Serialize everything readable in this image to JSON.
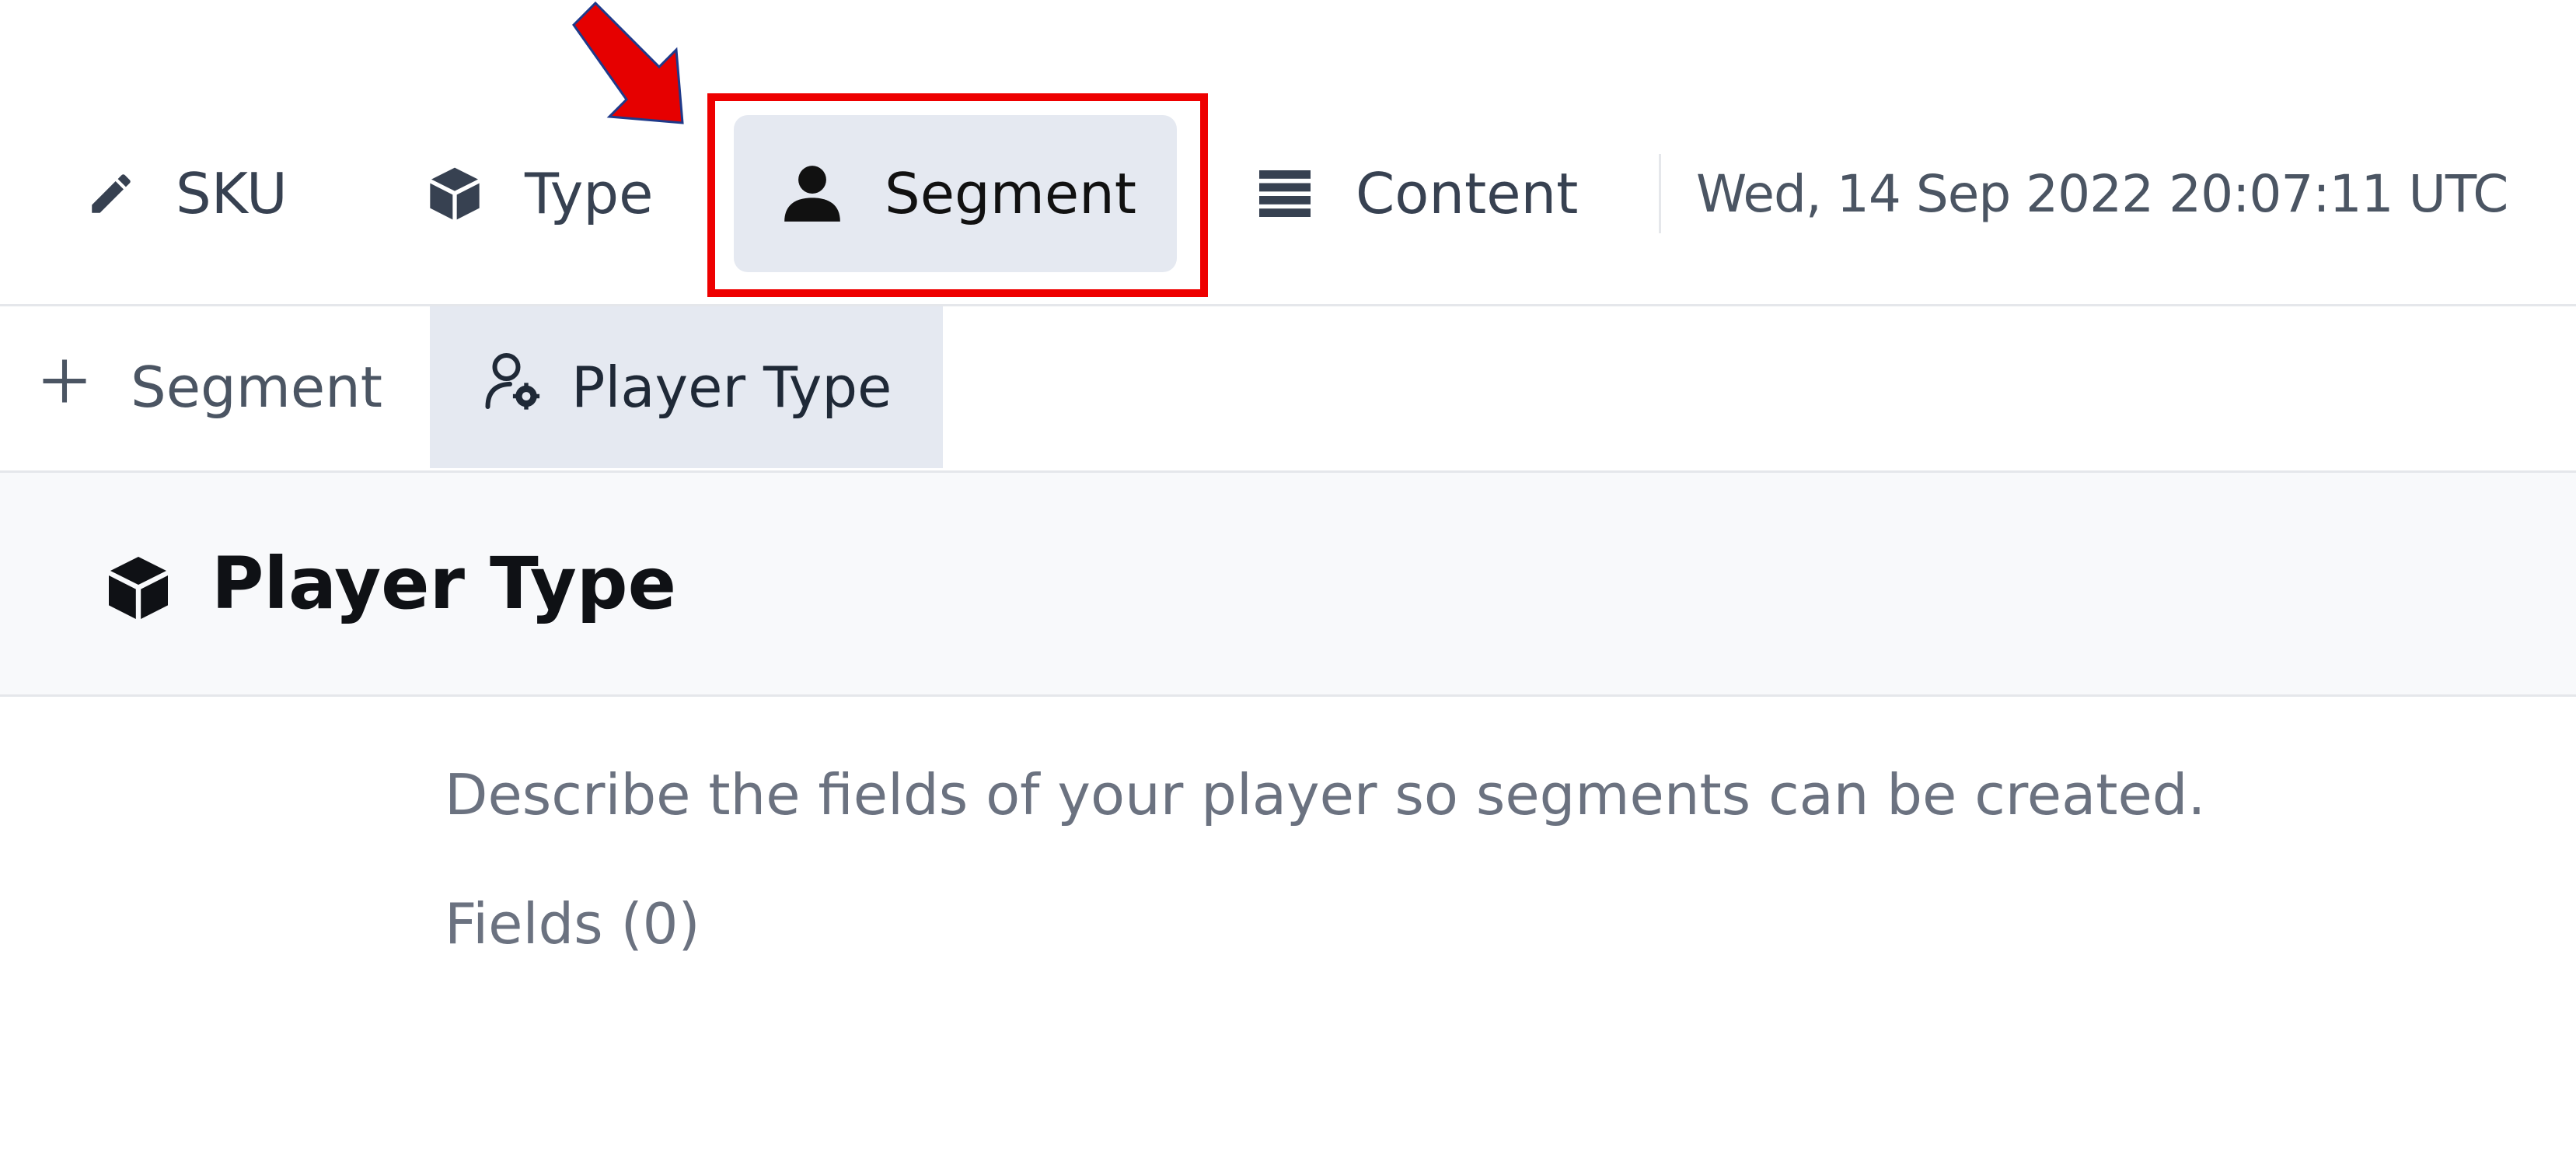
{
  "topnav": {
    "items": [
      {
        "label": "SKU",
        "icon": "pencil-icon"
      },
      {
        "label": "Type",
        "icon": "cube-icon"
      },
      {
        "label": "Segment",
        "icon": "user-icon",
        "active": true
      },
      {
        "label": "Content",
        "icon": "list-icon"
      }
    ],
    "timestamp": "Wed, 14 Sep 2022 20:07:11 UTC"
  },
  "subnav": {
    "items": [
      {
        "label": "Segment",
        "icon": "plus-icon"
      },
      {
        "label": "Player Type",
        "icon": "user-gear-icon",
        "active": true
      }
    ]
  },
  "header": {
    "title": "Player Type",
    "icon": "cube-icon"
  },
  "main": {
    "description": "Describe the fields of your player so segments can be created.",
    "fields_label": "Fields (0)"
  },
  "annotation": {
    "highlight_color": "#ee0000",
    "arrow_color": "#e60000"
  },
  "colors": {
    "active_bg": "#e5e9f1",
    "header_bg": "#f8f9fb",
    "muted_text": "#6b7280"
  }
}
